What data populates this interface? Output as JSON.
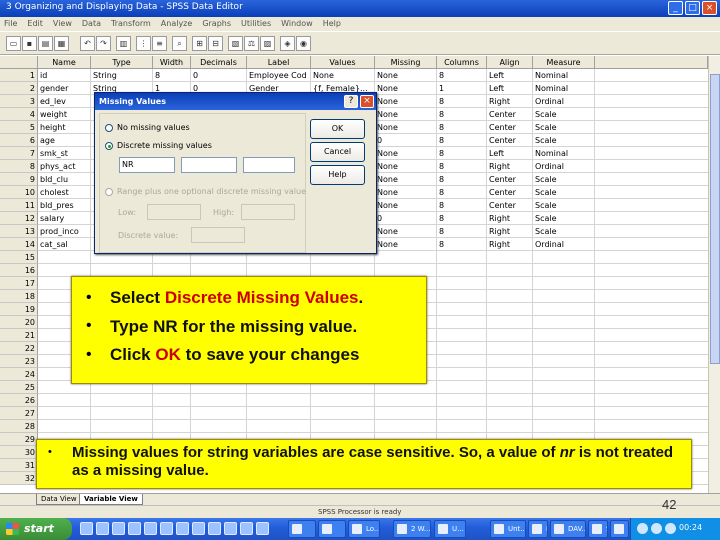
{
  "window": {
    "title": "3 Organizing and Displaying Data - SPSS Data Editor",
    "controls": [
      "_",
      "□",
      "×"
    ]
  },
  "menu": [
    "File",
    "Edit",
    "View",
    "Data",
    "Transform",
    "Analyze",
    "Graphs",
    "Utilities",
    "Window",
    "Help"
  ],
  "grid": {
    "headers": [
      "Name",
      "Type",
      "Width",
      "Decimals",
      "Label",
      "Values",
      "Missing",
      "Columns",
      "Align",
      "Measure"
    ],
    "rows": [
      [
        "1",
        "id",
        "String",
        "8",
        "0",
        "Employee Cod",
        "None",
        "None",
        "8",
        "Left",
        "Nominal"
      ],
      [
        "2",
        "gender",
        "String",
        "1",
        "0",
        "Gender",
        "{f, Female}...",
        "None",
        "1",
        "Left",
        "Nominal"
      ],
      [
        "3",
        "ed_lev",
        "",
        "",
        "",
        "",
        "",
        "None",
        "8",
        "Right",
        "Ordinal"
      ],
      [
        "4",
        "weight",
        "",
        "",
        "",
        "",
        "",
        "None",
        "8",
        "Center",
        "Scale"
      ],
      [
        "5",
        "height",
        "",
        "",
        "",
        "",
        "",
        "None",
        "8",
        "Center",
        "Scale"
      ],
      [
        "6",
        "age",
        "",
        "",
        "",
        "",
        "",
        "0",
        "8",
        "Center",
        "Scale"
      ],
      [
        "7",
        "smk_st",
        "",
        "",
        "",
        "",
        "",
        "None",
        "8",
        "Left",
        "Nominal"
      ],
      [
        "8",
        "phys_act",
        "",
        "",
        "",
        "",
        "",
        "None",
        "8",
        "Right",
        "Ordinal"
      ],
      [
        "9",
        "bld_clu",
        "",
        "",
        "",
        "",
        "",
        "None",
        "8",
        "Center",
        "Scale"
      ],
      [
        "10",
        "cholest",
        "",
        "",
        "",
        "",
        "",
        "None",
        "8",
        "Center",
        "Scale"
      ],
      [
        "11",
        "bld_pres",
        "",
        "",
        "",
        "",
        "",
        "None",
        "8",
        "Center",
        "Scale"
      ],
      [
        "12",
        "salary",
        "",
        "",
        "",
        "",
        "",
        "0",
        "8",
        "Right",
        "Scale"
      ],
      [
        "13",
        "prod_inco",
        "",
        "",
        "",
        "",
        "",
        "None",
        "8",
        "Right",
        "Scale"
      ],
      [
        "14",
        "cat_sal",
        "",
        "",
        "",
        "",
        "",
        "None",
        "8",
        "Right",
        "Ordinal"
      ],
      [
        "15"
      ],
      [
        "16"
      ],
      [
        "17"
      ],
      [
        "18"
      ],
      [
        "19"
      ],
      [
        "20"
      ],
      [
        "21"
      ],
      [
        "22"
      ],
      [
        "23"
      ],
      [
        "24"
      ],
      [
        "25"
      ],
      [
        "26"
      ],
      [
        "27"
      ],
      [
        "28"
      ],
      [
        "29"
      ],
      [
        "30"
      ],
      [
        "31"
      ],
      [
        "32"
      ]
    ]
  },
  "dialog": {
    "title": "Missing Values",
    "help_btn": "?",
    "close_btn": "×",
    "option_none": "No missing values",
    "option_discrete": "Discrete missing values",
    "discrete_value": "NR",
    "option_range": "Range plus one optional discrete missing value",
    "low_label": "Low:",
    "high_label": "High:",
    "discrete_label": "Discrete value:",
    "ok": "OK",
    "cancel": "Cancel",
    "help": "Help"
  },
  "callout": {
    "bullets": [
      {
        "pre": "Select ",
        "em": "Discrete Missing Values",
        "post": "."
      },
      {
        "pre": " Type NR for the missing value.",
        "em": "",
        "post": ""
      },
      {
        "pre": "Click ",
        "em": "OK",
        "post": " to save your changes"
      }
    ],
    "bullet_glyph": "•"
  },
  "note": {
    "bullet": "•",
    "text_pre": "Missing values for string variables are case sensitive. So, a value of ",
    "text_em": "nr",
    "text_post": " is not treated as a missing value."
  },
  "tabs": {
    "data_view": "Data View",
    "variable_view": "Variable View"
  },
  "status": "SPSS Processor is ready",
  "page_number": "42",
  "taskbar": {
    "start": "start",
    "tasks": [
      "",
      "",
      "Lo...",
      "2 W...",
      "U...",
      "Unt...",
      "Lect...",
      "DAV...",
      "S...",
      "",
      "S..."
    ],
    "clock": "00:24"
  },
  "colors": {
    "accent": "#cc0000",
    "callout": "#ffff00",
    "titlebar": "#0a3fb8"
  }
}
